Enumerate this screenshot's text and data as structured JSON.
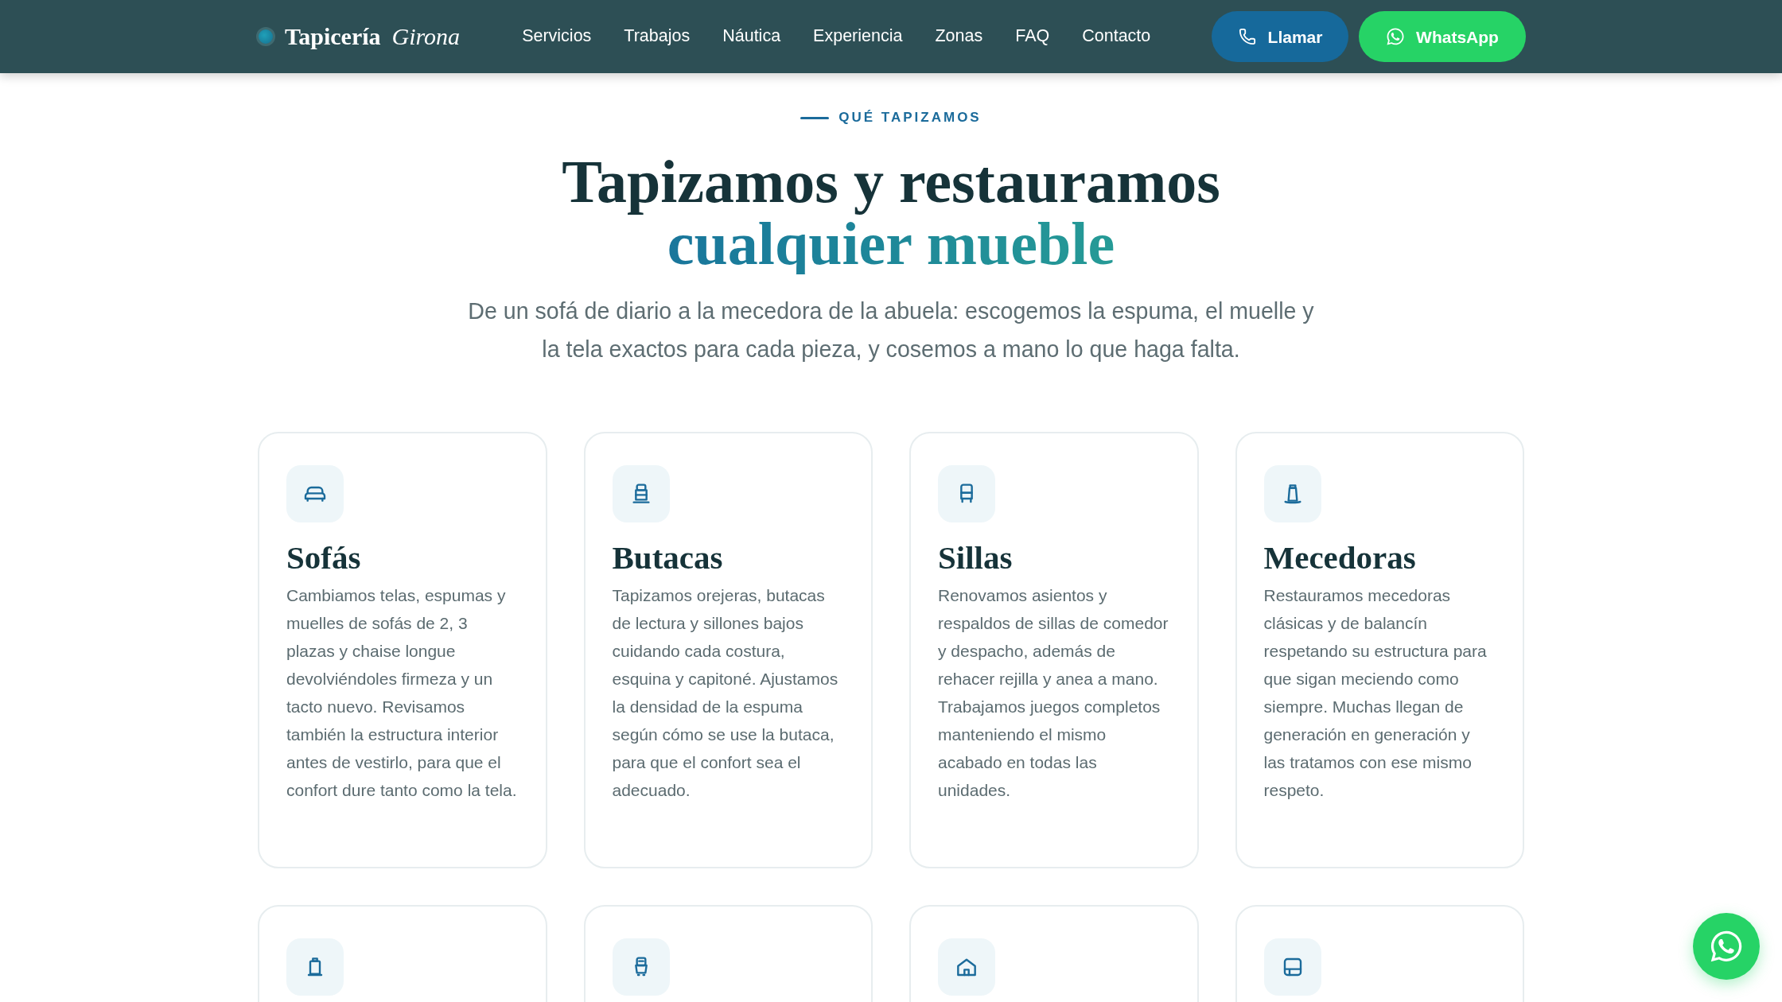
{
  "header": {
    "logo": {
      "name": "Tapicería",
      "accent": "Girona"
    },
    "nav": [
      "Servicios",
      "Trabajos",
      "Náutica",
      "Experiencia",
      "Zonas",
      "FAQ",
      "Contacto"
    ],
    "buttons": [
      {
        "kind": "call",
        "label": "Llamar"
      },
      {
        "kind": "whatsapp",
        "label": "WhatsApp"
      }
    ]
  },
  "section": {
    "eyebrow": "QUÉ TAPIZAMOS",
    "heading": {
      "text": "Tapizamos y restauramos",
      "highlight": "cualquier mueble"
    },
    "intro": "De un sofá de diario a la mecedora de la abuela: escogemos la espuma, el muelle y la tela exactos para cada pieza, y cosemos a mano lo que haga falta."
  },
  "cards": [
    {
      "kind": "sofa",
      "title": "Sofás",
      "description": "Cambiamos telas, espumas y muelles de sofás de 2, 3 plazas y chaise longue devolviéndoles firmeza y un tacto nuevo. Revisamos también la estructura interior antes de vestirlo, para que el confort dure tanto como la tela."
    },
    {
      "kind": "armchair",
      "title": "Butacas",
      "description": "Tapizamos orejeras, butacas de lectura y sillones bajos cuidando cada costura, esquina y capitoné. Ajustamos la densidad de la espuma según cómo se use la butaca, para que el confort sea el adecuado."
    },
    {
      "kind": "chair",
      "title": "Sillas",
      "description": "Renovamos asientos y respaldos de sillas de comedor y despacho, además de rehacer rejilla y anea a mano. Trabajamos juegos completos manteniendo el mismo acabado en todas las unidades."
    },
    {
      "kind": "rocker",
      "title": "Mecedoras",
      "description": "Restauramos mecedoras clásicas y de balancín respetando su estructura para que sigan meciendo como siempre. Muchas llegan de generación en generación y las tratamos con ese mismo respeto."
    },
    {
      "kind": "ottoman"
    },
    {
      "kind": "seat"
    },
    {
      "kind": "house"
    },
    {
      "kind": "panel"
    }
  ]
}
